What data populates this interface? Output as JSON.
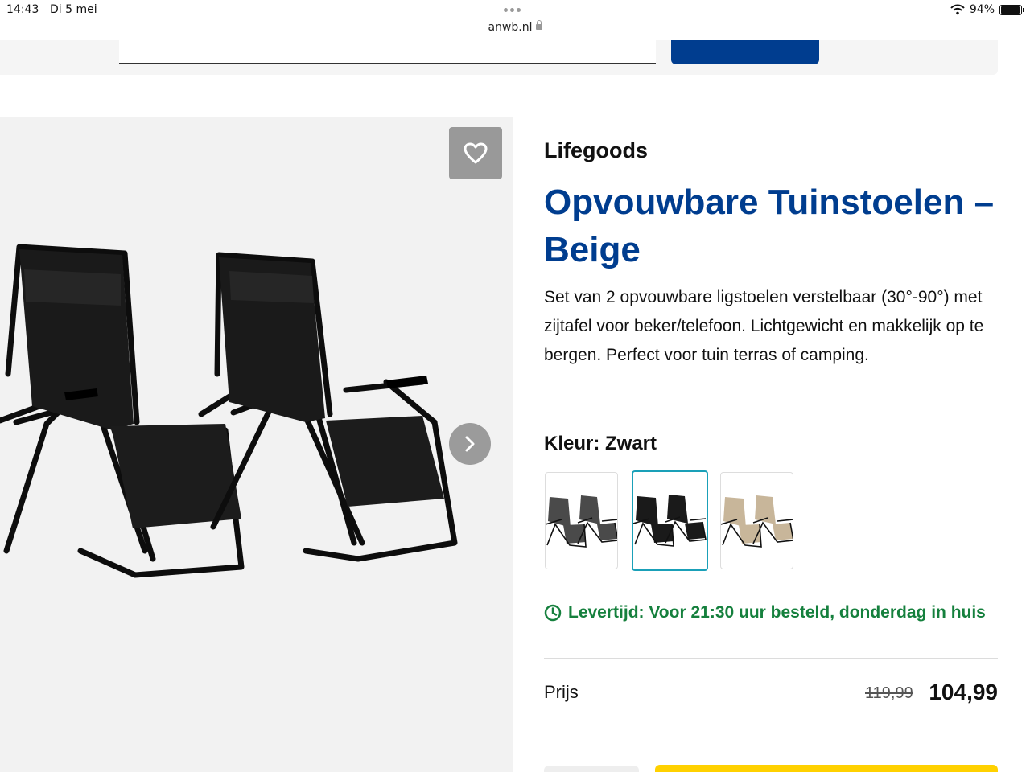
{
  "status_bar": {
    "time": "14:43",
    "date": "Di 5 mei",
    "url": "anwb.nl",
    "battery": "94%",
    "battery_level": 0.94
  },
  "product": {
    "brand": "Lifegoods",
    "title": "Opvouwbare Tuinstoelen – Beige",
    "description": "Set van 2 opvouwbare ligstoelen verstelbaar (30°-90°) met zijtafel voor beker/telefoon. Lichtgewicht en makkelijk op te bergen. Perfect voor tuin terras of camping.",
    "color_label": "Kleur: Zwart",
    "swatches": [
      {
        "name": "Grijs",
        "color": "#4a4a4a",
        "selected": false
      },
      {
        "name": "Zwart",
        "color": "#1a1a1a",
        "selected": true
      },
      {
        "name": "Beige",
        "color": "#c8b69a",
        "selected": false
      }
    ],
    "delivery": "Levertijd: Voor 21:30 uur besteld, donderdag in huis",
    "price_label": "Prijs",
    "old_price": "119,99",
    "new_price": "104,99"
  },
  "colors": {
    "brand_blue": "#003d8f",
    "delivery_green": "#15803d",
    "cta_yellow": "#ffd100",
    "selected_border": "#1aa0b8"
  },
  "icons": {
    "favorite": "heart-icon",
    "next": "chevron-right-icon",
    "delivery": "clock-icon",
    "wifi": "wifi-icon",
    "lock": "lock-icon",
    "battery": "battery-icon"
  }
}
